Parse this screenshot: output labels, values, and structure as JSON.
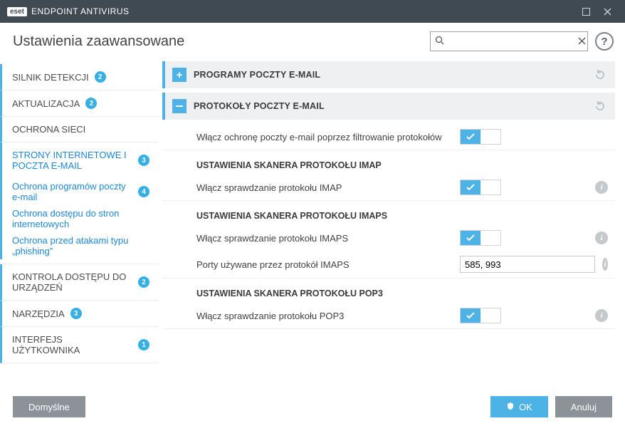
{
  "window": {
    "title": "ENDPOINT ANTIVIRUS",
    "brand": "eset"
  },
  "page_title": "Ustawienia zaawansowane",
  "search": {
    "placeholder": ""
  },
  "sidebar": [
    {
      "label": "SILNIK DETEKCJI",
      "badge": "2",
      "kind": "plain"
    },
    {
      "label": "AKTUALIZACJA",
      "badge": "2",
      "kind": "plain"
    },
    {
      "label": "OCHRONA SIECI",
      "badge": "",
      "kind": "plain"
    },
    {
      "label": "STRONY INTERNETOWE I POCZTA E-MAIL",
      "badge": "3",
      "kind": "parent",
      "children": [
        {
          "label": "Ochrona programów poczty e-mail",
          "badge": "4",
          "bold": true
        },
        {
          "label": "Ochrona dostępu do stron internetowych",
          "badge": ""
        },
        {
          "label": "Ochrona przed atakami typu „phishing”",
          "badge": ""
        }
      ]
    },
    {
      "label": "KONTROLA DOSTĘPU DO URZĄDZEŃ",
      "badge": "2",
      "kind": "plain"
    },
    {
      "label": "NARZĘDZIA",
      "badge": "3",
      "kind": "plain"
    },
    {
      "label": "INTERFEJS UŻYTKOWNIKA",
      "badge": "1",
      "kind": "plain"
    }
  ],
  "sections": {
    "emailPrograms": {
      "title": "PROGRAMY POCZTY E-MAIL",
      "expanded": false
    },
    "emailProtocols": {
      "title": "PROTOKOŁY POCZTY E-MAIL",
      "expanded": true,
      "enable_row": "Włącz ochronę poczty e-mail poprzez filtrowanie protokołów",
      "imap": {
        "heading": "USTAWIENIA SKANERA PROTOKOŁU IMAP",
        "enable": "Włącz sprawdzanie protokołu IMAP"
      },
      "imaps": {
        "heading": "USTAWIENIA SKANERA PROTOKOŁU IMAPS",
        "enable": "Włącz sprawdzanie protokołu IMAPS",
        "ports_label": "Porty używane przez protokół IMAPS",
        "ports_value": "585, 993"
      },
      "pop3": {
        "heading": "USTAWIENIA SKANERA PROTOKOŁU POP3",
        "enable": "Włącz sprawdzanie protokołu POP3"
      }
    }
  },
  "footer": {
    "default": "Domyślne",
    "ok": "OK",
    "cancel": "Anuluj"
  }
}
